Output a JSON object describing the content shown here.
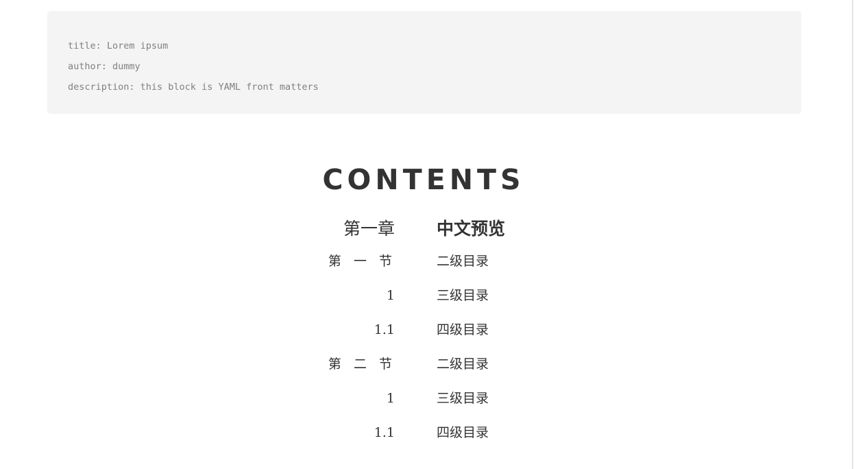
{
  "frontmatter": {
    "lines": [
      "title: Lorem ipsum",
      "author: dummy",
      "description: this block is YAML front matters"
    ]
  },
  "contents": {
    "title": "CONTENTS",
    "entries": [
      {
        "num": "第一章",
        "text": "中文预览"
      },
      {
        "num": "第 一 节",
        "text": "二级目录"
      },
      {
        "num": "1",
        "text": "三级目录"
      },
      {
        "num": "1.1",
        "text": "四级目录"
      },
      {
        "num": "第 二 节",
        "text": "二级目录"
      },
      {
        "num": "1",
        "text": "三级目录"
      },
      {
        "num": "1.1",
        "text": "四级目录"
      }
    ]
  }
}
